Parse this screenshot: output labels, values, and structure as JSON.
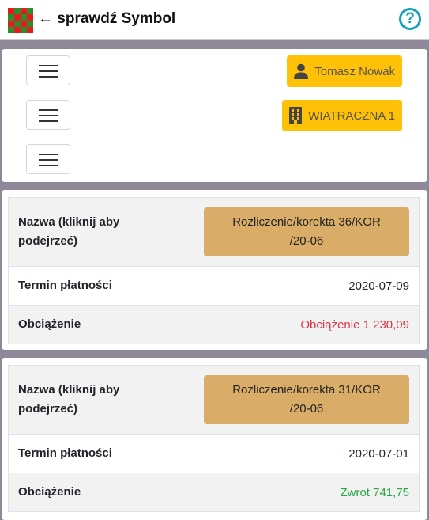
{
  "header": {
    "title": "← sprawdź Symbol",
    "help_label": "?",
    "logo_colors": [
      "#2e8b2e",
      "#e51c1c"
    ]
  },
  "nav": {
    "user_name": "Tomasz Nowak",
    "location_name": "WIATRACZNA 1",
    "accent": "#ffc107"
  },
  "records": [
    {
      "name_label": "Nazwa (kliknij aby podejrzeć)",
      "name_value": "Rozliczenie/korekta 36/KOR /20-06",
      "due_label": "Termin płatności",
      "due_value": "2020-07-09",
      "charge_label": "Obciążenie",
      "charge_value": "Obciążenie 1 230,09",
      "charge_color": "#dc3545"
    },
    {
      "name_label": "Nazwa (kliknij aby podejrzeć)",
      "name_value": "Rozliczenie/korekta 31/KOR /20-06",
      "due_label": "Termin płatności",
      "due_value": "2020-07-01",
      "charge_label": "Obciążenie",
      "charge_value": "Zwrot 741,75",
      "charge_color": "#28a745"
    }
  ]
}
